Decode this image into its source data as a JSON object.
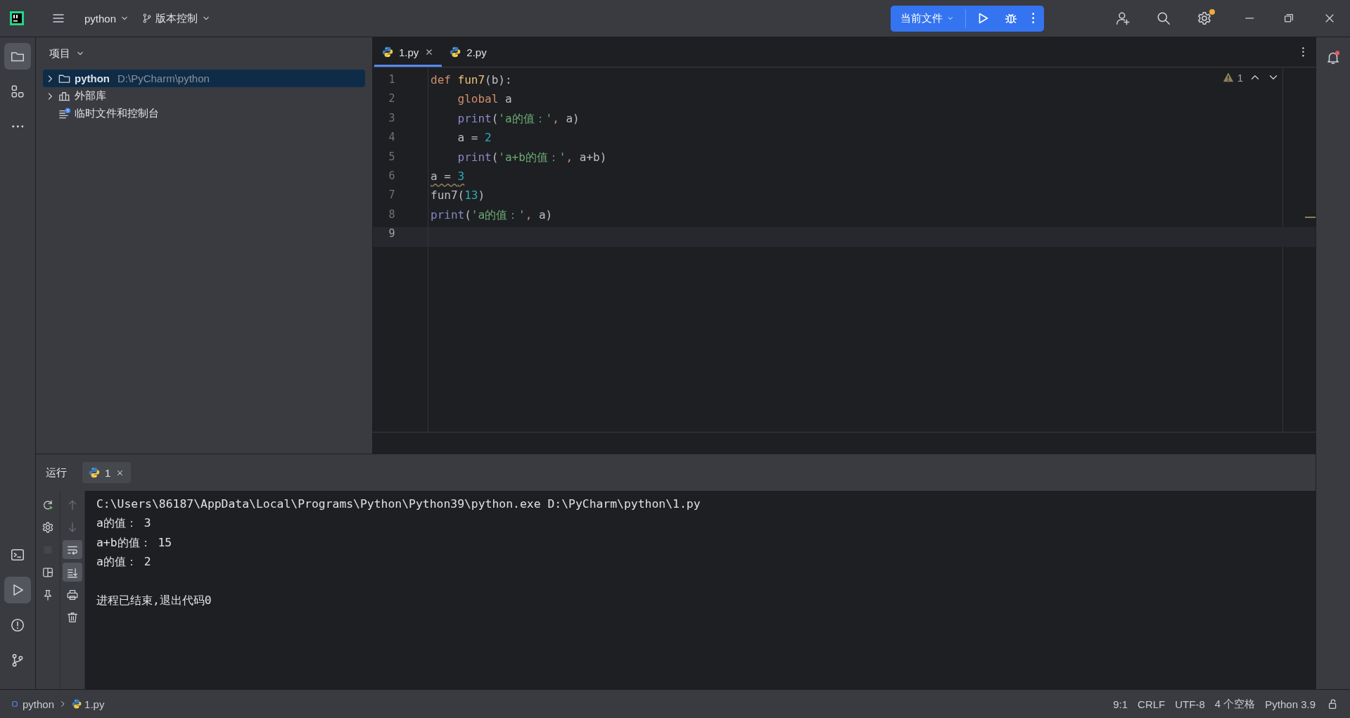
{
  "title_bar": {
    "project": "python",
    "vcs": "版本控制",
    "run_config": "当前文件"
  },
  "left_stripe": {
    "top": [
      {
        "kind": "project",
        "selected": true
      },
      {
        "kind": "structure",
        "selected": false
      },
      {
        "kind": "more",
        "selected": false
      }
    ],
    "bottom": [
      {
        "kind": "terminal",
        "selected": false
      },
      {
        "kind": "run",
        "selected": true
      },
      {
        "kind": "problems",
        "selected": false
      },
      {
        "kind": "git",
        "selected": false
      }
    ]
  },
  "project_panel": {
    "title": "项目",
    "tree": [
      {
        "label": "python",
        "path": "D:\\PyCharm\\python",
        "kind": "folder",
        "expanded": false,
        "selected": true
      },
      {
        "label": "外部库",
        "kind": "library",
        "expanded": false,
        "selected": false
      },
      {
        "label": "临时文件和控制台",
        "kind": "scratch",
        "selected": false
      }
    ]
  },
  "editor": {
    "tabs": [
      {
        "label": "1.py",
        "selected": true,
        "closable": true
      },
      {
        "label": "2.py",
        "selected": false,
        "closable": false
      }
    ],
    "warning_count": "1",
    "lines": [
      {
        "number": "1",
        "current": false,
        "indented": false,
        "warning": false,
        "tokens": [
          {
            "text": "def ",
            "kind": "keyword"
          },
          {
            "text": "fun7",
            "kind": "function"
          },
          {
            "text": "(b):",
            "kind": "plain"
          }
        ]
      },
      {
        "number": "2",
        "current": false,
        "indented": true,
        "warning": false,
        "tokens": [
          {
            "text": "global",
            "kind": "keyword"
          },
          {
            "text": " a",
            "kind": "plain"
          }
        ]
      },
      {
        "number": "3",
        "current": false,
        "indented": true,
        "warning": false,
        "tokens": [
          {
            "text": "print",
            "kind": "builtin"
          },
          {
            "text": "(",
            "kind": "plain"
          },
          {
            "text": "'a的值：'",
            "kind": "string"
          },
          {
            "text": ", ",
            "kind": "punct"
          },
          {
            "text": "a)",
            "kind": "plain"
          }
        ]
      },
      {
        "number": "4",
        "current": false,
        "indented": true,
        "warning": false,
        "tokens": [
          {
            "text": "a = ",
            "kind": "plain"
          },
          {
            "text": "2",
            "kind": "number"
          }
        ]
      },
      {
        "number": "5",
        "current": false,
        "indented": true,
        "warning": false,
        "tokens": [
          {
            "text": "print",
            "kind": "builtin"
          },
          {
            "text": "(",
            "kind": "plain"
          },
          {
            "text": "'a+b的值：'",
            "kind": "string"
          },
          {
            "text": ", ",
            "kind": "punct"
          },
          {
            "text": "a+b)",
            "kind": "plain"
          }
        ]
      },
      {
        "number": "6",
        "current": false,
        "indented": false,
        "warning": true,
        "tokens": [
          {
            "text": "a = ",
            "kind": "plain"
          },
          {
            "text": "3",
            "kind": "number"
          }
        ]
      },
      {
        "number": "7",
        "current": false,
        "indented": false,
        "warning": false,
        "tokens": [
          {
            "text": "fun7(",
            "kind": "plain"
          },
          {
            "text": "13",
            "kind": "number"
          },
          {
            "text": ")",
            "kind": "plain"
          }
        ]
      },
      {
        "number": "8",
        "current": false,
        "indented": false,
        "warning": false,
        "tokens": [
          {
            "text": "print",
            "kind": "builtin"
          },
          {
            "text": "(",
            "kind": "plain"
          },
          {
            "text": "'a的值：'",
            "kind": "string"
          },
          {
            "text": ", ",
            "kind": "punct"
          },
          {
            "text": "a)",
            "kind": "plain"
          }
        ]
      },
      {
        "number": "9",
        "current": true
      }
    ]
  },
  "run_panel": {
    "title": "运行",
    "tabs": [
      {
        "label": "1",
        "selected": true
      }
    ],
    "side_tools": [
      {
        "kind": "rerun",
        "disabled": false
      },
      {
        "kind": "settings",
        "disabled": false
      },
      {
        "kind": "stop",
        "disabled": true
      },
      {
        "kind": "layout",
        "disabled": false
      },
      {
        "kind": "pin",
        "disabled": false
      }
    ],
    "output_tools": [
      {
        "kind": "up",
        "disabled": true,
        "on": false
      },
      {
        "kind": "down",
        "disabled": true,
        "on": false
      },
      {
        "kind": "wrap",
        "disabled": false,
        "on": true
      },
      {
        "kind": "scroll-end",
        "disabled": false,
        "on": true
      },
      {
        "kind": "print",
        "disabled": false,
        "on": false
      },
      {
        "kind": "delete",
        "disabled": false,
        "on": false
      }
    ],
    "console": [
      {
        "text": "C:\\Users\\86187\\AppData\\Local\\Programs\\Python\\Python39\\python.exe D:\\PyCharm\\python\\1.py",
        "gap_before": false
      },
      {
        "text": "a的值： 3",
        "gap_before": false
      },
      {
        "text": "a+b的值： 15",
        "gap_before": false
      },
      {
        "text": "a的值： 2",
        "gap_before": false
      },
      {
        "text": "进程已结束,退出代码0",
        "gap_before": true
      }
    ]
  },
  "status_bar": {
    "breadcrumbs": [
      {
        "label": "python",
        "kind": "module"
      },
      {
        "label": "1.py",
        "kind": "python"
      }
    ],
    "items": [
      "9:1",
      "CRLF",
      "UTF-8",
      "4 个空格",
      "Python 3.9"
    ]
  }
}
